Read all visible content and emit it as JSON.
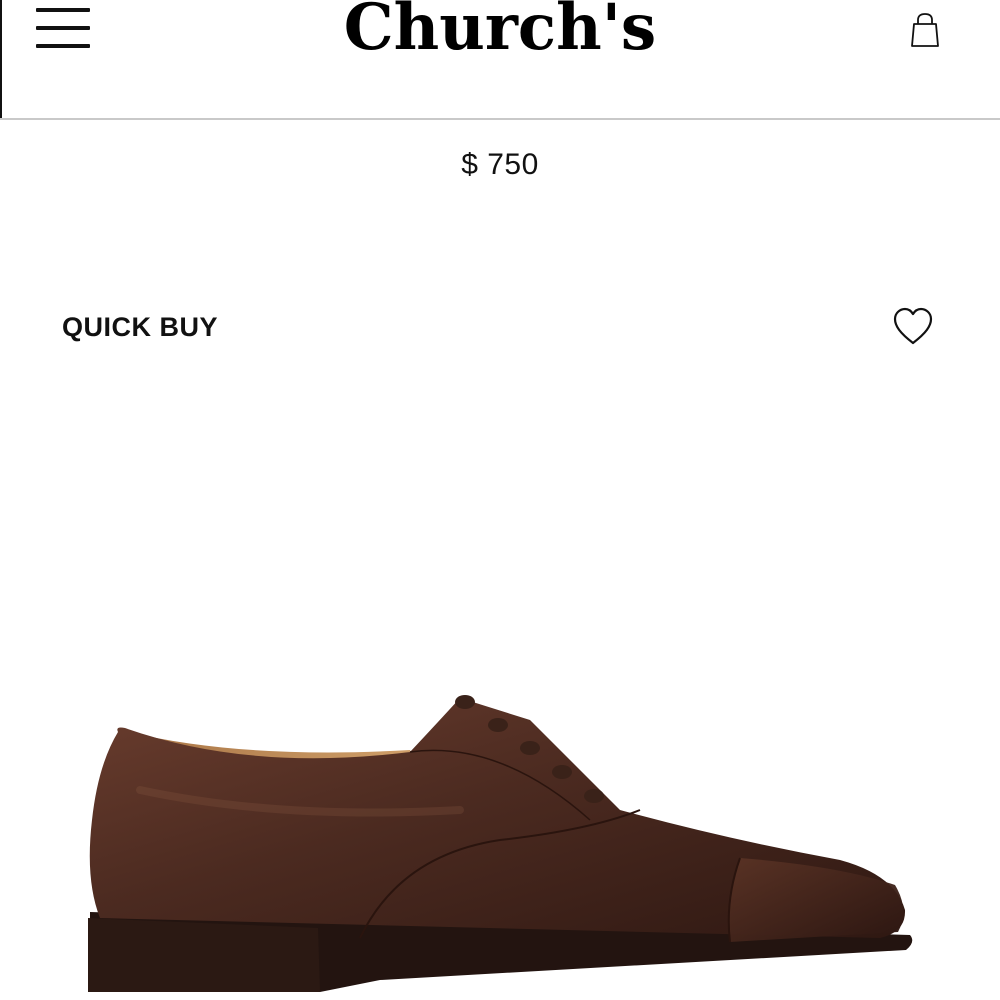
{
  "header": {
    "brand": "Church's",
    "menu_icon": "hamburger-menu-icon",
    "bag_icon": "shopping-bag-icon"
  },
  "product": {
    "price": "$ 750",
    "quick_buy_label": "QUICK BUY",
    "wishlist_icon": "heart-icon",
    "image_description_colors": {
      "leather": "#4a2a20",
      "sole": "#2a1a15",
      "lining": "#c9965e"
    }
  }
}
